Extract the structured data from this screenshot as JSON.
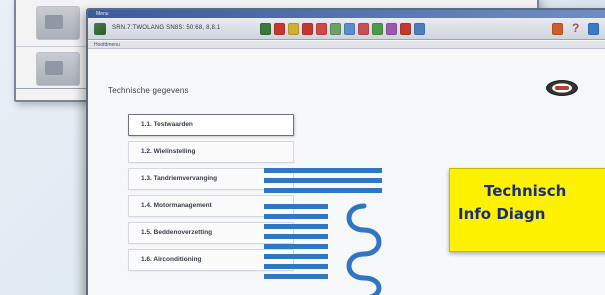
{
  "back_window": {
    "items": [
      {
        "icon": "thumbnail-icon"
      },
      {
        "icon": "thumbnail-icon"
      }
    ]
  },
  "main_window": {
    "title": "Menu",
    "toolbar": {
      "path": "SRN.7:TWOLANG SN8S: 50:68, 8,8.1",
      "help_glyph": "?"
    },
    "breadcrumb": "Hoofdmenu",
    "section_heading": "Technische gegevens",
    "menu_items": [
      {
        "label": "1.1.  Testwaarden",
        "active": true
      },
      {
        "label": "1.2.  Wielinstelling",
        "active": false
      },
      {
        "label": "1.3.  Tandriemvervanging",
        "active": false
      },
      {
        "label": "1.4.  Motormanagement",
        "active": false
      },
      {
        "label": "1.5.  Beddenoverzetting",
        "active": false
      },
      {
        "label": "1.6.  Airconditioning",
        "active": false
      }
    ]
  },
  "badge": {
    "line1": "Technisch",
    "line2": "Info Diagn"
  },
  "colors": {
    "badge_bg": "#fff200",
    "badge_text": "#1a2d7a",
    "doc_blue": "#2f76c6",
    "window_border": "#5f6a7c"
  }
}
